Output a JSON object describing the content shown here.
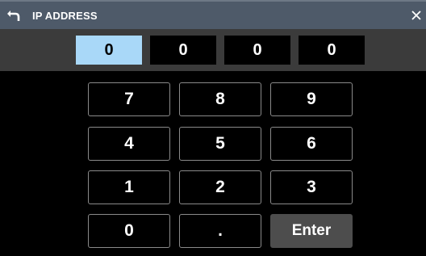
{
  "header": {
    "title": "IP ADDRESS",
    "back_icon": "back-arrow-icon",
    "close_icon": "close-icon"
  },
  "ip_address": {
    "octets": [
      "0",
      "0",
      "0",
      "0"
    ],
    "selected_octet_index": 0
  },
  "keypad": {
    "keys": [
      "7",
      "8",
      "9",
      "4",
      "5",
      "6",
      "1",
      "2",
      "3",
      "0",
      ".",
      "Enter"
    ]
  },
  "colors": {
    "titlebar": "#4e5a69",
    "selected_octet": "#a9d8f8",
    "enter_key": "#4d4d4d"
  }
}
